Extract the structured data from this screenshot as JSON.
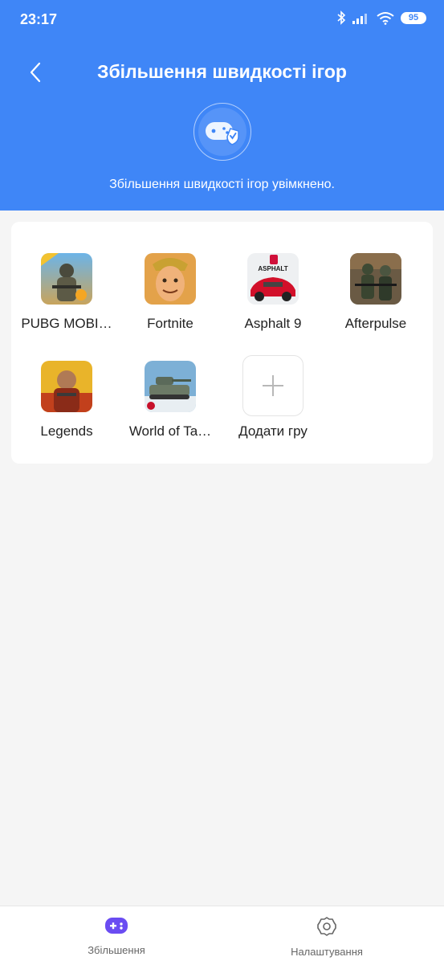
{
  "status_bar": {
    "time": "23:17",
    "battery": "95"
  },
  "header": {
    "title": "Збільшення швидкості ігор",
    "subtitle": "Збільшення швидкості ігор увімкнено."
  },
  "games": [
    {
      "label": "PUBG MOBI…",
      "icon": "pubg-icon"
    },
    {
      "label": "Fortnite",
      "icon": "fortnite-icon"
    },
    {
      "label": "Asphalt 9",
      "icon": "asphalt-icon",
      "badge": "ASPHALT"
    },
    {
      "label": "Afterpulse",
      "icon": "afterpulse-icon"
    },
    {
      "label": "Legends",
      "icon": "legends-icon"
    },
    {
      "label": "World of Ta…",
      "icon": "world-of-tanks-icon"
    }
  ],
  "add_game": {
    "label": "Додати гру"
  },
  "nav": {
    "boost_label": "Збільшення",
    "settings_label": "Налаштування"
  },
  "colors": {
    "header_bg": "#3f86f7",
    "nav_active": "#6a4cf2"
  }
}
